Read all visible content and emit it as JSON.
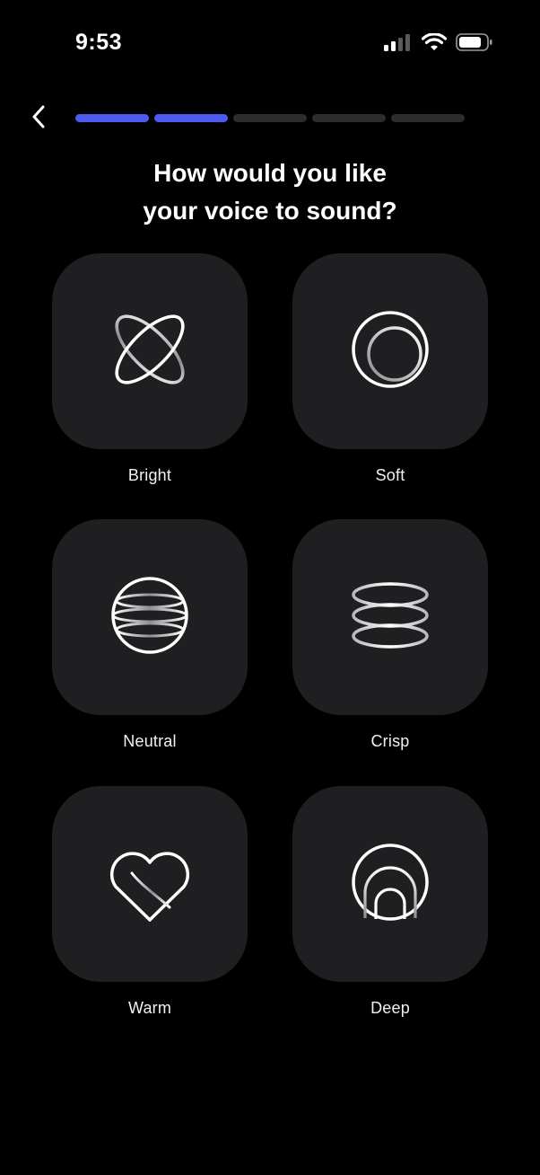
{
  "status_bar": {
    "time": "9:53",
    "icons": [
      "cellular-signal-icon",
      "wifi-icon",
      "battery-icon"
    ]
  },
  "header": {
    "back_icon": "chevron-left-icon",
    "progress": {
      "total_steps": 5,
      "current_step": 2
    }
  },
  "title": {
    "line1": "How would you like",
    "line2": "your voice to sound?"
  },
  "options": [
    {
      "label": "Bright",
      "icon": "bright-voice-icon"
    },
    {
      "label": "Soft",
      "icon": "soft-voice-icon"
    },
    {
      "label": "Neutral",
      "icon": "neutral-voice-icon"
    },
    {
      "label": "Crisp",
      "icon": "crisp-voice-icon"
    },
    {
      "label": "Warm",
      "icon": "warm-voice-icon"
    },
    {
      "label": "Deep",
      "icon": "deep-voice-icon"
    }
  ],
  "colors": {
    "background": "#000000",
    "tile": "#1f1f21",
    "progress_active": "#4c5af0",
    "progress_inactive": "#2c2c2e",
    "text": "#ffffff"
  }
}
